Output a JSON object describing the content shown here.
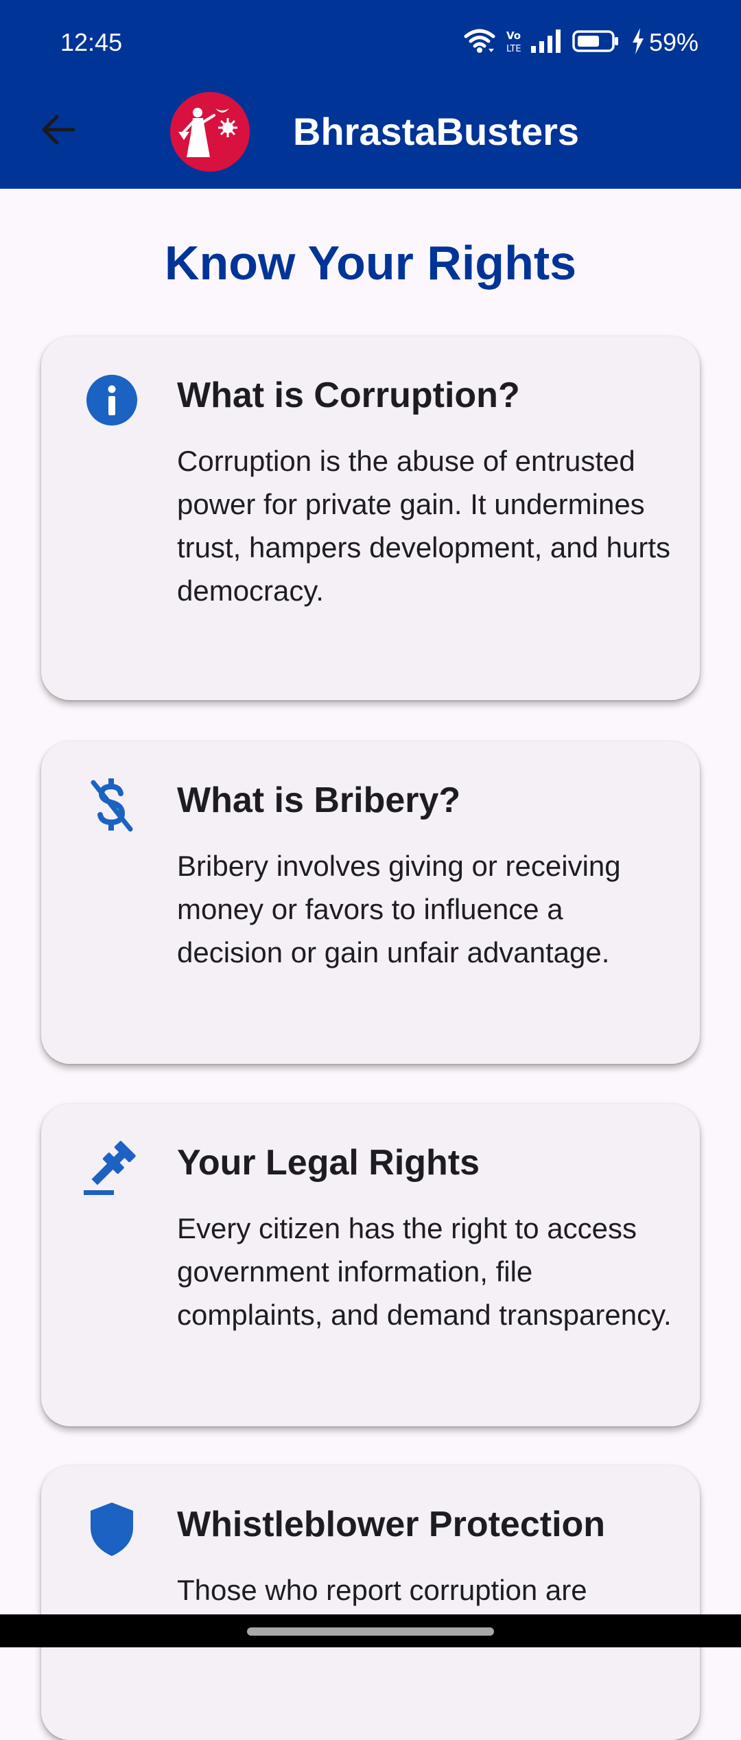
{
  "status_bar": {
    "time": "12:45",
    "network_label": "Vo LTE",
    "battery": "59%"
  },
  "app_bar": {
    "title": "BhrastaBusters",
    "back_icon": "arrow-left-icon",
    "logo": "justice-emblem-logo"
  },
  "page": {
    "title": "Know Your Rights"
  },
  "cards": [
    {
      "icon": "info-icon",
      "title": "What is Corruption?",
      "body": "Corruption is the abuse of entrusted power for private gain. It undermines trust, hampers development, and hurts democracy."
    },
    {
      "icon": "money-off-icon",
      "title": "What is Bribery?",
      "body": "Bribery involves giving or receiving money or favors to influence a decision or gain unfair advantage."
    },
    {
      "icon": "gavel-icon",
      "title": "Your Legal Rights",
      "body": "Every citizen has the right to access government information, file complaints, and demand transparency."
    },
    {
      "icon": "shield-icon",
      "title": "Whistleblower Protection",
      "body": "Those who report corruption are"
    }
  ],
  "colors": {
    "app_bar": "#013497",
    "accent": "#1b62c2",
    "logo_bg": "#d9113f",
    "background": "#fcf7fc",
    "card_bg": "#f4f0f6"
  }
}
